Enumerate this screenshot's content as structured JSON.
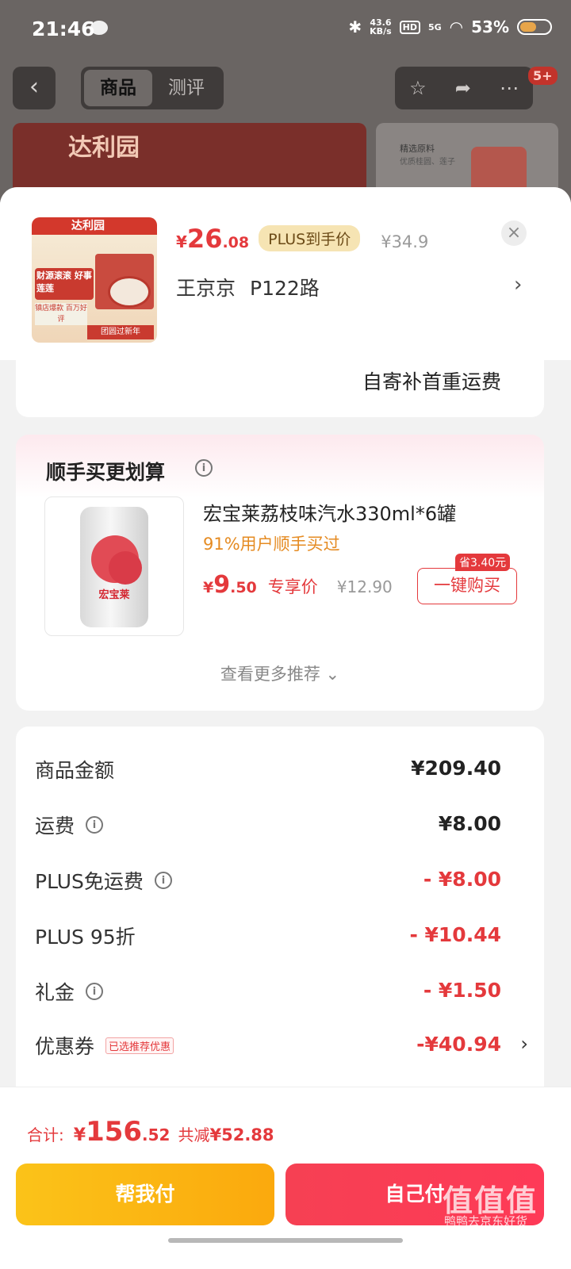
{
  "status_bar": {
    "time": "21:46",
    "speed_top": "43.6",
    "speed_unit": "KB/s",
    "hd": "HD",
    "network": "5G",
    "battery": "53%"
  },
  "nav": {
    "back": "‹",
    "tabs": [
      "商品",
      "测评"
    ],
    "badge": "5+"
  },
  "banner": {
    "brand": "达利园",
    "side_title": "精选原料",
    "side_sub": "优质桂圆、莲子"
  },
  "sheet": {
    "product_thumb": {
      "logo": "达利园",
      "slogan": "财源滚滚 好事莲莲",
      "sub": "镇店爆款 百万好评",
      "footer": "团圆过新年"
    },
    "price": {
      "yen": "¥",
      "int": "26",
      "dec": ".08",
      "plus_tag": "PLUS到手价",
      "orig": "¥34.9"
    },
    "close": "×",
    "spec": {
      "name": "王京京",
      "addr": "P122路",
      "chev": "›"
    },
    "shipping_note": "自寄补首重运费",
    "recommend": {
      "title": "顺手买更划算",
      "info": "i",
      "can_label": "宏宝莱",
      "name": "宏宝莱荔枝味汽水330ml*6罐",
      "pct": "91%用户顺手买过",
      "price_yen": "¥",
      "price_int": "9",
      "price_dec": ".50",
      "exclusive": "专享价",
      "old": "¥12.90",
      "save": "省3.40元",
      "buy": "一键购买",
      "more": "查看更多推荐 ⌄"
    },
    "summary": [
      {
        "label": "商品金额",
        "value": "¥209.40"
      },
      {
        "label": "运费",
        "value": "¥8.00"
      },
      {
        "label": "PLUS免运费",
        "value": "- ¥8.00"
      },
      {
        "label": "PLUS 95折",
        "value": "- ¥10.44"
      },
      {
        "label": "礼金",
        "value": "- ¥1.50"
      },
      {
        "label": "优惠券",
        "tag": "已选推荐优惠",
        "value": "-¥40.94",
        "chev": "›"
      }
    ]
  },
  "footer": {
    "total_label": "合计:",
    "yen": "¥",
    "int": "156",
    "dec": ".52",
    "save_label": "共减",
    "save_value": "¥52.88",
    "help_pay": "帮我付",
    "self_pay": "自己付",
    "watermark": "值值值",
    "watermark_sub": "鸭鸭去京东好货"
  },
  "colors": {
    "accent": "#e4393c",
    "help_btn": "#fbc319",
    "self_btn": "#f64053",
    "plus_tag": "#f6e4b3"
  }
}
